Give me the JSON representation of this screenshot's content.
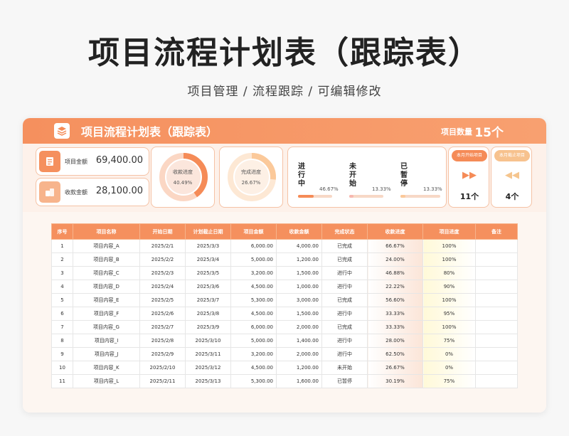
{
  "title": "项目流程计划表（跟踪表）",
  "subtitle": "项目管理 /  流程跟踪  /  可编辑修改",
  "header": {
    "title": "项目流程计划表（跟踪表）",
    "count_label": "项目数量",
    "count_value": "15个"
  },
  "amounts": [
    {
      "label": "项目金额",
      "value": "69,400.00",
      "icon": "edit-doc-icon"
    },
    {
      "label": "收款金额",
      "value": "28,100.00",
      "icon": "coins-icon"
    }
  ],
  "donuts": [
    {
      "label": "收款进度",
      "percent_text": "40.49%",
      "value": 0.4049,
      "color": "#f58b57",
      "track": "#fbd7c4"
    },
    {
      "label": "完成进度",
      "percent_text": "26.67%",
      "value": 0.2667,
      "color": "#fbc99a",
      "track": "#fde8d4"
    }
  ],
  "status": [
    {
      "label": "进行中",
      "percent_text": "46.67%",
      "value": 0.4667,
      "color": "#f58b57"
    },
    {
      "label": "未开始",
      "percent_text": "13.33%",
      "value": 0.1333,
      "color": "#f7b8b0"
    },
    {
      "label": "已暂停",
      "percent_text": "13.33%",
      "value": 0.1333,
      "color": "#fbc99a"
    }
  ],
  "month": [
    {
      "tag": "本月开始项目",
      "value": "11个",
      "icon": "double-right-arrow-icon",
      "color": "#f58b57",
      "tag_color": "#f58b57"
    },
    {
      "tag": "本月截止项目",
      "value": "4个",
      "icon": "double-left-arrow-icon",
      "color": "#f5c58e",
      "tag_color": "#f7c28e"
    }
  ],
  "table": {
    "headers": [
      "序号",
      "项目名称",
      "开始日期",
      "计划截止日期",
      "项目金额",
      "收款金额",
      "完成状态",
      "收款进度",
      "项目进度",
      "备注"
    ],
    "rows": [
      [
        "1",
        "项目内容_A",
        "2025/2/1",
        "2025/3/3",
        "6,000.00",
        "4,000.00",
        "已完成",
        "66.67%",
        "100%",
        ""
      ],
      [
        "2",
        "项目内容_B",
        "2025/2/2",
        "2025/3/4",
        "5,000.00",
        "1,200.00",
        "已完成",
        "24.00%",
        "100%",
        ""
      ],
      [
        "3",
        "项目内容_C",
        "2025/2/3",
        "2025/3/5",
        "3,200.00",
        "1,500.00",
        "进行中",
        "46.88%",
        "80%",
        ""
      ],
      [
        "4",
        "项目内容_D",
        "2025/2/4",
        "2025/3/6",
        "4,500.00",
        "1,000.00",
        "进行中",
        "22.22%",
        "90%",
        ""
      ],
      [
        "5",
        "项目内容_E",
        "2025/2/5",
        "2025/3/7",
        "5,300.00",
        "3,000.00",
        "已完成",
        "56.60%",
        "100%",
        ""
      ],
      [
        "6",
        "项目内容_F",
        "2025/2/6",
        "2025/3/8",
        "4,500.00",
        "1,500.00",
        "进行中",
        "33.33%",
        "95%",
        ""
      ],
      [
        "7",
        "项目内容_G",
        "2025/2/7",
        "2025/3/9",
        "6,000.00",
        "2,000.00",
        "已完成",
        "33.33%",
        "100%",
        ""
      ],
      [
        "8",
        "项目内容_I",
        "2025/2/8",
        "2025/3/10",
        "5,000.00",
        "1,400.00",
        "进行中",
        "28.00%",
        "75%",
        ""
      ],
      [
        "9",
        "项目内容_J",
        "2025/2/9",
        "2025/3/11",
        "3,200.00",
        "2,000.00",
        "进行中",
        "62.50%",
        "0%",
        ""
      ],
      [
        "10",
        "项目内容_K",
        "2025/2/10",
        "2025/3/12",
        "4,500.00",
        "1,200.00",
        "未开始",
        "26.67%",
        "0%",
        ""
      ],
      [
        "11",
        "项目内容_L",
        "2025/2/11",
        "2025/3/13",
        "5,300.00",
        "1,600.00",
        "已暂停",
        "30.19%",
        "75%",
        ""
      ]
    ]
  }
}
